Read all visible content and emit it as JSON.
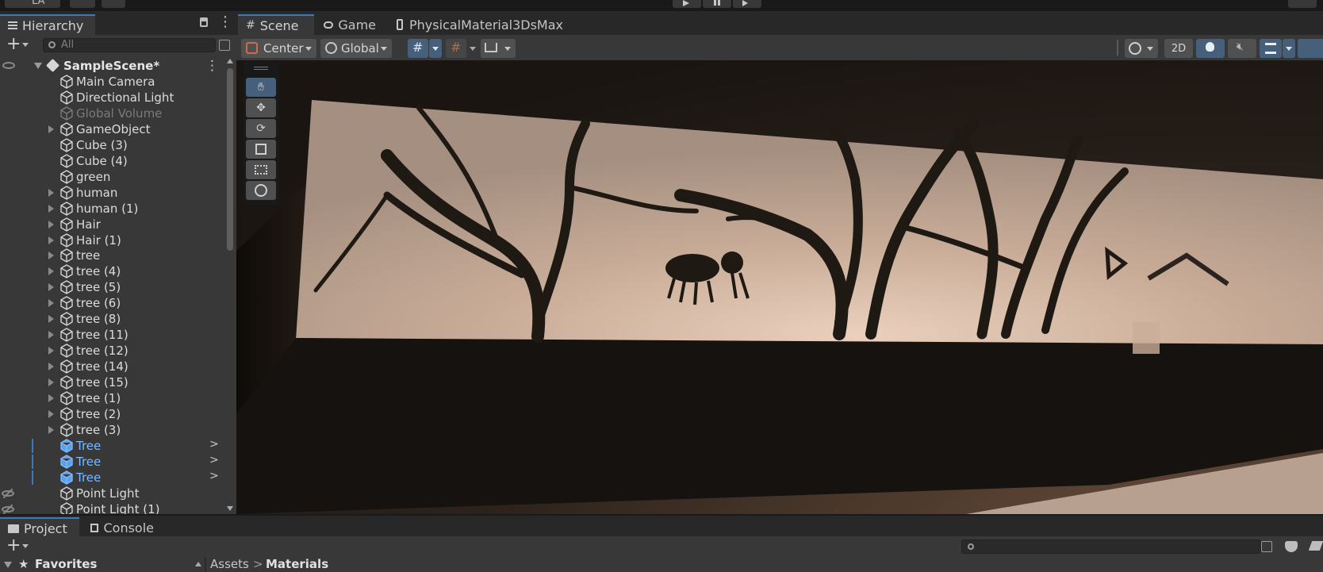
{
  "toolbar": {
    "account_label": "LA",
    "play_icon": "play-icon",
    "pause_icon": "pause-icon",
    "step_icon": "step-icon"
  },
  "hierarchy": {
    "tab_label": "Hierarchy",
    "search_placeholder": "All",
    "scene_name": "SampleScene*",
    "items": [
      {
        "label": "Main Camera",
        "expandable": false,
        "state": "normal"
      },
      {
        "label": "Directional Light",
        "expandable": false,
        "state": "normal"
      },
      {
        "label": "Global Volume",
        "expandable": false,
        "state": "disabled"
      },
      {
        "label": "GameObject",
        "expandable": true,
        "state": "normal"
      },
      {
        "label": "Cube (3)",
        "expandable": false,
        "state": "normal"
      },
      {
        "label": "Cube (4)",
        "expandable": false,
        "state": "normal"
      },
      {
        "label": "green",
        "expandable": false,
        "state": "normal"
      },
      {
        "label": "human",
        "expandable": true,
        "state": "normal"
      },
      {
        "label": "human (1)",
        "expandable": true,
        "state": "normal"
      },
      {
        "label": "Hair",
        "expandable": true,
        "state": "normal"
      },
      {
        "label": "Hair (1)",
        "expandable": true,
        "state": "normal"
      },
      {
        "label": "tree",
        "expandable": true,
        "state": "normal"
      },
      {
        "label": "tree (4)",
        "expandable": true,
        "state": "normal"
      },
      {
        "label": "tree (5)",
        "expandable": true,
        "state": "normal"
      },
      {
        "label": "tree (6)",
        "expandable": true,
        "state": "normal"
      },
      {
        "label": "tree (8)",
        "expandable": true,
        "state": "normal"
      },
      {
        "label": "tree (11)",
        "expandable": true,
        "state": "normal"
      },
      {
        "label": "tree (12)",
        "expandable": true,
        "state": "normal"
      },
      {
        "label": "tree (14)",
        "expandable": true,
        "state": "normal"
      },
      {
        "label": "tree (15)",
        "expandable": true,
        "state": "normal"
      },
      {
        "label": "tree (1)",
        "expandable": true,
        "state": "normal"
      },
      {
        "label": "tree (2)",
        "expandable": true,
        "state": "normal"
      },
      {
        "label": "tree (3)",
        "expandable": true,
        "state": "normal"
      },
      {
        "label": "Tree",
        "expandable": false,
        "state": "prefab"
      },
      {
        "label": "Tree",
        "expandable": false,
        "state": "prefab"
      },
      {
        "label": "Tree",
        "expandable": false,
        "state": "prefab"
      },
      {
        "label": "Point Light",
        "expandable": false,
        "state": "normal"
      },
      {
        "label": "Point Light (1)",
        "expandable": false,
        "state": "normal"
      }
    ]
  },
  "scene": {
    "tabs": [
      "Scene",
      "Game",
      "PhysicalMaterial3DsMax"
    ],
    "pivot_label": "Center",
    "space_label": "Global",
    "mode_2d_label": "2D"
  },
  "project": {
    "tabs": [
      "Project",
      "Console"
    ],
    "favorites_label": "Favorites",
    "breadcrumb": [
      "Assets",
      "Materials"
    ]
  },
  "colors": {
    "accent": "#3a79bb",
    "prefab_text": "#7cb8ff",
    "panel_bg": "#383838",
    "viewport_wall": "#c9ad98"
  }
}
